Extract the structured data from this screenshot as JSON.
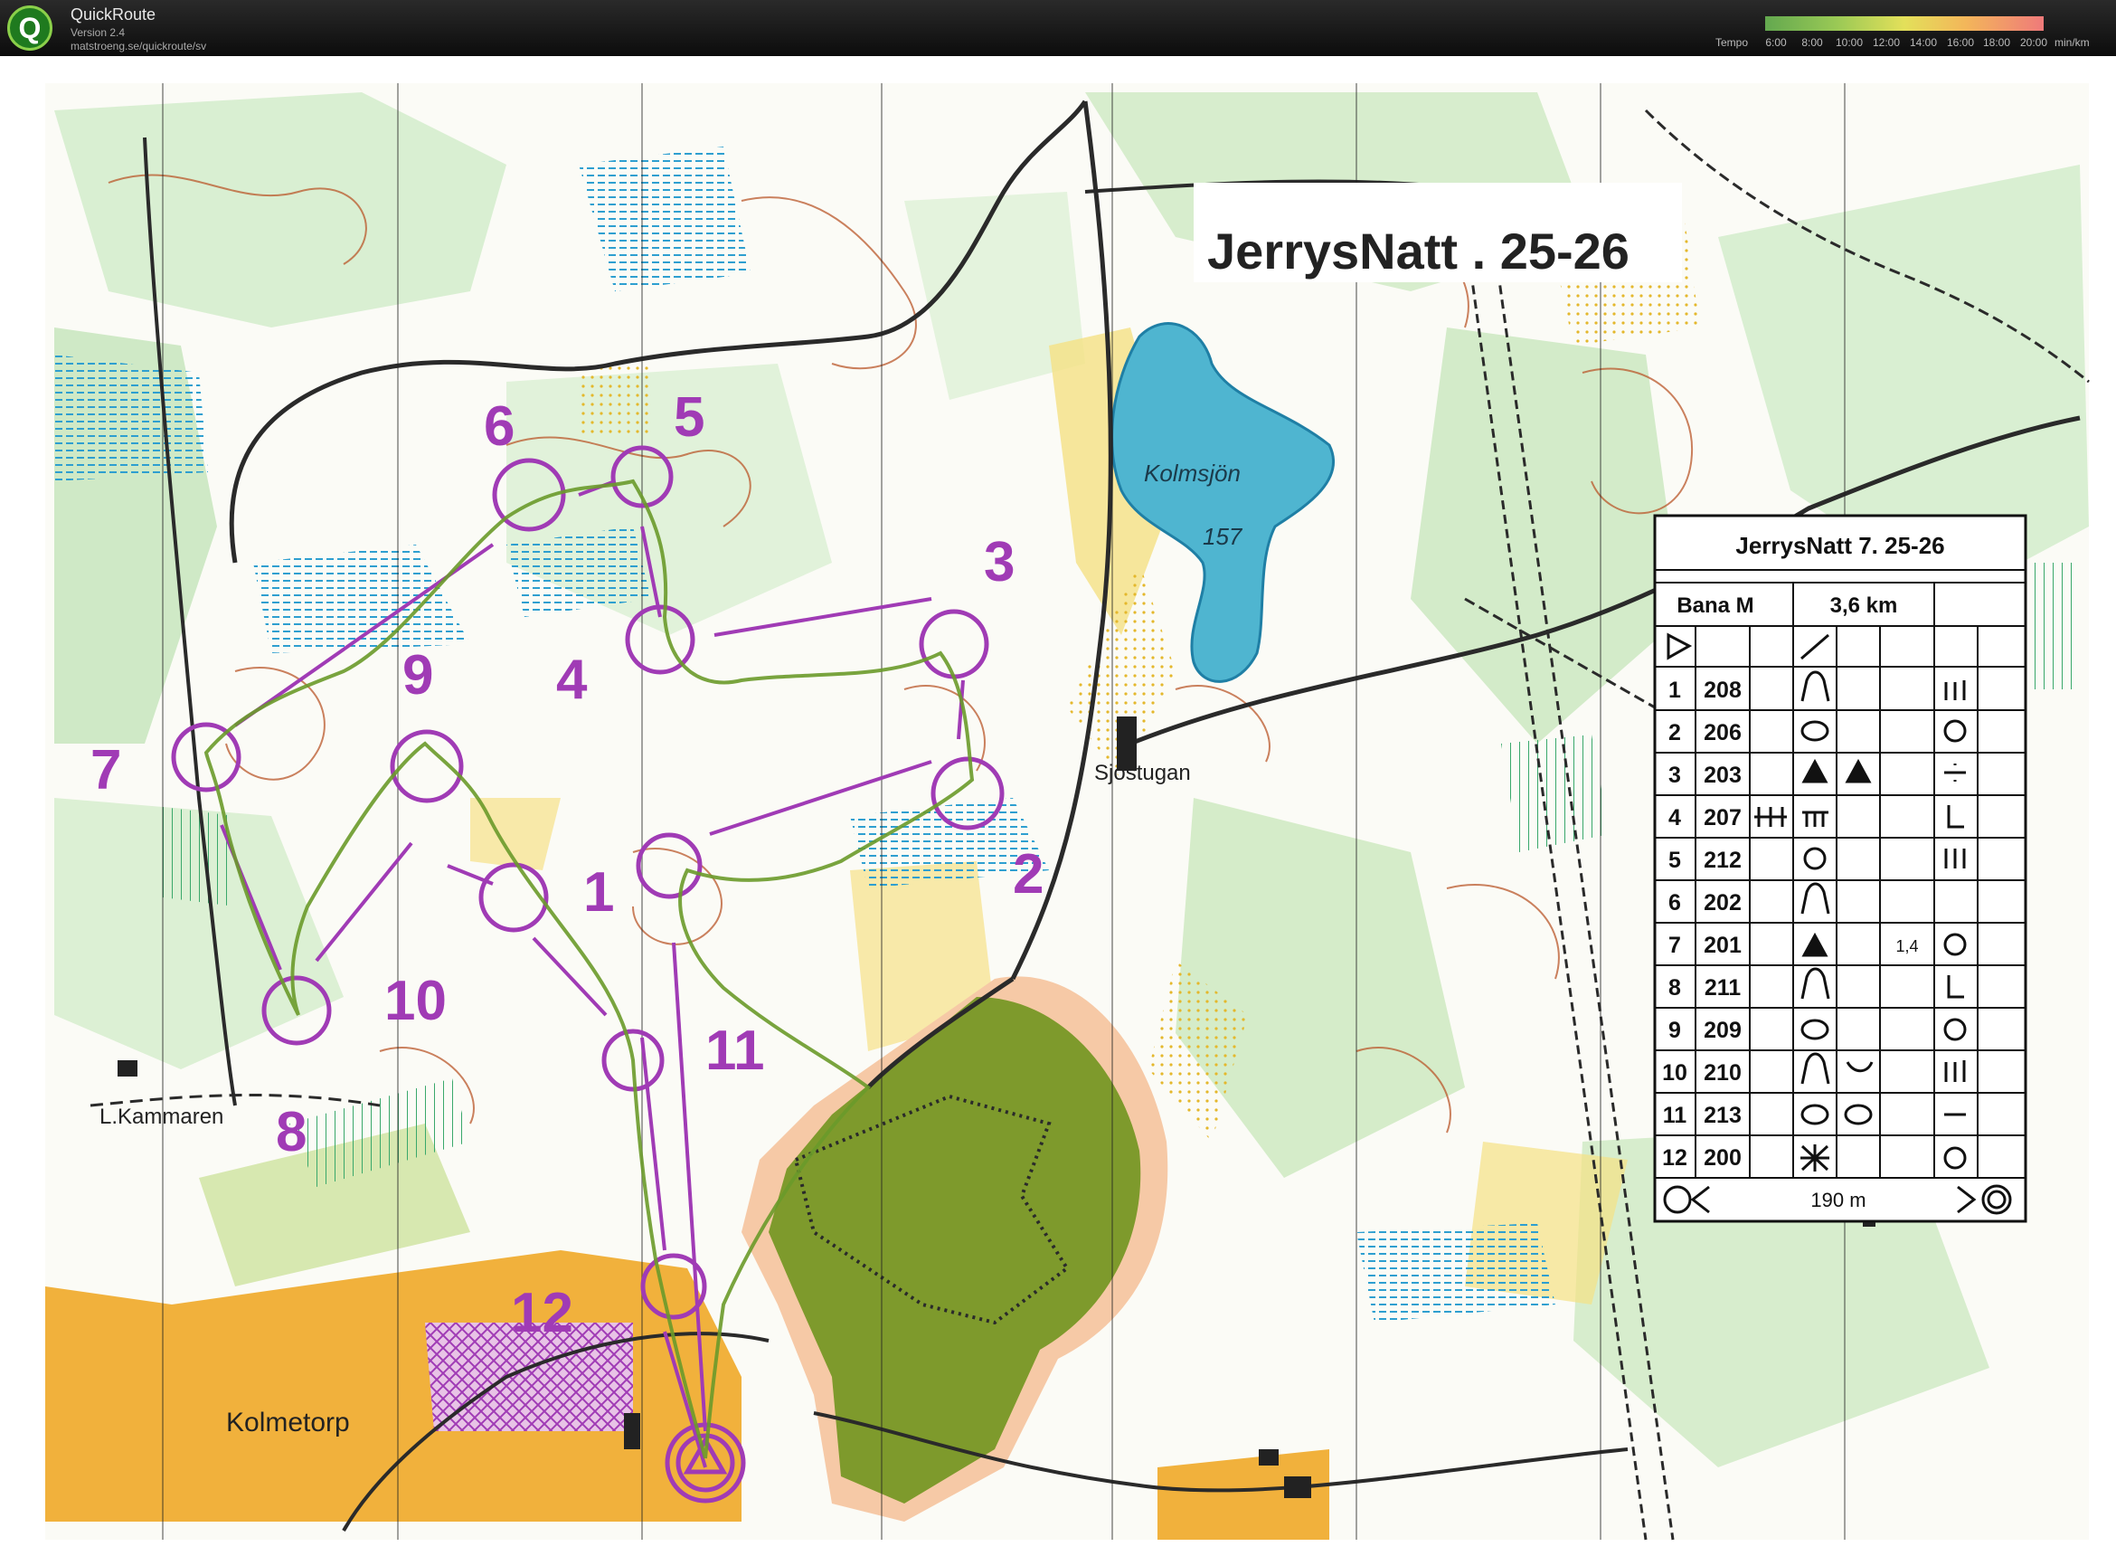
{
  "app": {
    "title": "QuickRoute",
    "version": "Version 2.4",
    "url": "matstroeng.se/quickroute/sv",
    "logo_letter": "Q"
  },
  "tempo": {
    "label": "Tempo",
    "ticks": [
      "6:00",
      "8:00",
      "10:00",
      "12:00",
      "14:00",
      "16:00",
      "18:00",
      "20:00"
    ],
    "unit": "min/km",
    "colors": [
      "#63a84f",
      "#98c855",
      "#e3e05a",
      "#f3b65a",
      "#ef7a7a"
    ]
  },
  "map": {
    "title": "JerrysNatt . 25-26",
    "lake_name": "Kolmsjön",
    "lake_height": "157",
    "place_names": [
      "Sjöstugan",
      "L.Kammaren",
      "Kolmetorp"
    ],
    "control_numbers": [
      "1",
      "2",
      "3",
      "4",
      "5",
      "6",
      "7",
      "8",
      "9",
      "10",
      "11",
      "12"
    ],
    "colors": {
      "course": "#a03bb5",
      "route": "#6a9a2a",
      "water": "#4fb5d0",
      "forest_green": "#c9e7c0",
      "open_yellow": "#f5e184",
      "field_orange": "#f1b13c",
      "contour": "#b9572a",
      "quarry_green": "#7e9a2c"
    }
  },
  "control_description": {
    "title": "JerrysNatt 7. 25-26",
    "course": "Bana M",
    "length": "3,6 km",
    "rows": [
      {
        "num": "1",
        "code": "208",
        "symbol_d": "reentrant-icon",
        "symbol_g": "northern-side-icon"
      },
      {
        "num": "2",
        "code": "206",
        "symbol_d": "thicket-icon",
        "symbol_g": "center-icon"
      },
      {
        "num": "3",
        "code": "203",
        "symbol_d": "boulder-icon",
        "symbol_e": "boulder-icon",
        "symbol_g": "between-icon"
      },
      {
        "num": "4",
        "code": "207",
        "symbol_c": "middle-icon",
        "symbol_d": "rocky-ground-icon",
        "symbol_g": "foot-icon"
      },
      {
        "num": "5",
        "code": "212",
        "symbol_d": "knoll-icon",
        "symbol_g": "southern-side-icon"
      },
      {
        "num": "6",
        "code": "202",
        "symbol_d": "reentrant-icon"
      },
      {
        "num": "7",
        "code": "201",
        "symbol_d": "boulder-icon",
        "symbol_f": "1,4",
        "symbol_g": "top-icon"
      },
      {
        "num": "8",
        "code": "211",
        "symbol_d": "reentrant-icon",
        "symbol_g": "foot-icon"
      },
      {
        "num": "9",
        "code": "209",
        "symbol_d": "thicket-icon",
        "symbol_g": "edge-icon"
      },
      {
        "num": "10",
        "code": "210",
        "symbol_d": "reentrant-icon",
        "symbol_e": "bend-icon",
        "symbol_g": "northern-side-icon"
      },
      {
        "num": "11",
        "code": "213",
        "symbol_d": "thicket-icon",
        "symbol_e": "thicket-icon",
        "symbol_g": "between-icon"
      },
      {
        "num": "12",
        "code": "200",
        "symbol_d": "ruin-icon",
        "symbol_g": "edge-icon"
      }
    ],
    "finish_distance": "190 m"
  }
}
